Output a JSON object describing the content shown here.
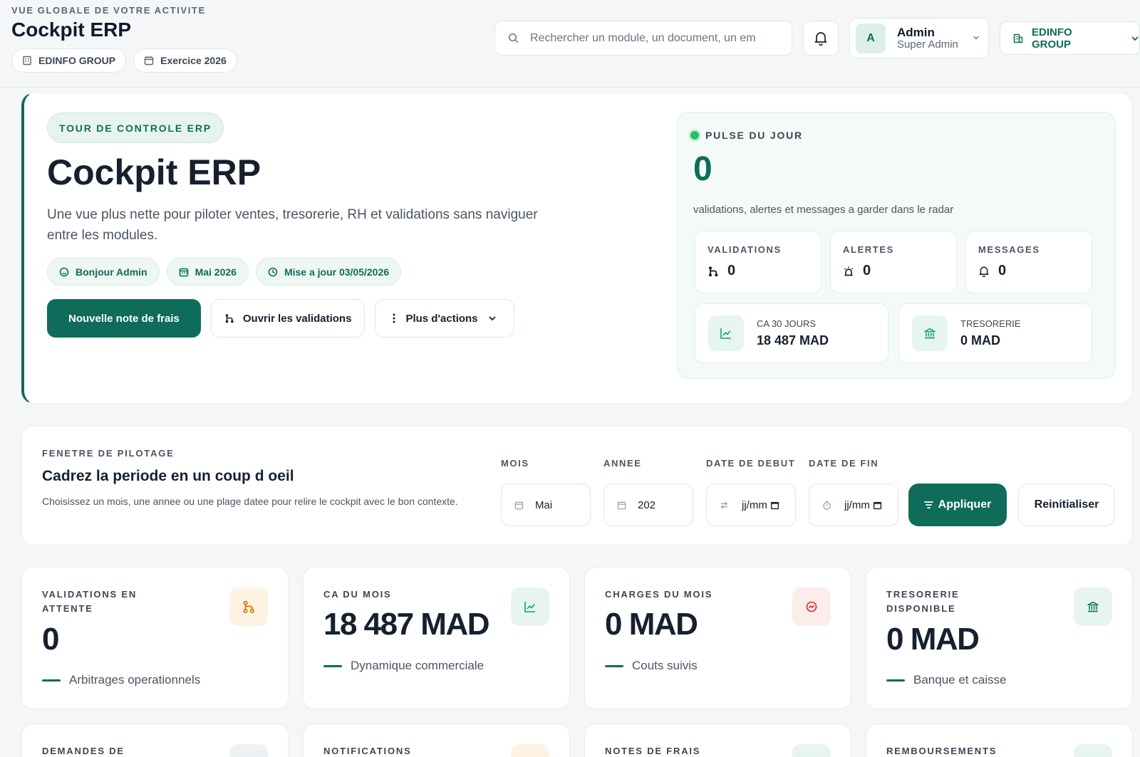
{
  "header": {
    "eyebrow": "VUE GLOBALE DE VOTRE ACTIVITE",
    "title": "Cockpit ERP",
    "company_chip": "EDINFO GROUP",
    "fiscal_chip": "Exercice 2026",
    "search_placeholder": "Rechercher un module, un document, un em",
    "user": {
      "initial": "A",
      "name": "Admin",
      "role": "Super Admin"
    },
    "company_selector": "EDINFO GROUP"
  },
  "hero": {
    "badge": "TOUR DE CONTROLE ERP",
    "title": "Cockpit ERP",
    "description": "Une vue plus nette pour piloter ventes, tresorerie, RH et validations sans naviguer entre les modules.",
    "pills": {
      "greeting": "Bonjour Admin",
      "month": "Mai 2026",
      "updated": "Mise a jour 03/05/2026"
    },
    "actions": {
      "primary": "Nouvelle note de frais",
      "validations": "Ouvrir les validations",
      "more": "Plus d'actions"
    }
  },
  "pulse": {
    "title": "PULSE DU JOUR",
    "value": "0",
    "caption": "validations, alertes et messages a garder dans le radar",
    "validations": {
      "label": "VALIDATIONS",
      "value": "0"
    },
    "alerts": {
      "label": "ALERTES",
      "value": "0"
    },
    "messages": {
      "label": "MESSAGES",
      "value": "0"
    },
    "revenue30": {
      "label": "CA 30 JOURS",
      "value": "18 487 MAD"
    },
    "treasury": {
      "label": "TRESORERIE",
      "value": "0 MAD"
    }
  },
  "filter": {
    "eyebrow": "FENETRE DE PILOTAGE",
    "title": "Cadrez la periode en un coup d oeil",
    "description": "Choisissez un mois, une annee ou une plage datee pour relire le cockpit avec le bon contexte.",
    "month": {
      "label": "MOIS",
      "value": "Mai"
    },
    "year": {
      "label": "ANNEE",
      "value": "202"
    },
    "start": {
      "label": "DATE DE DEBUT",
      "value": "jj/mm"
    },
    "end": {
      "label": "DATE DE FIN",
      "value": "jj/mm"
    },
    "apply": "Appliquer",
    "reset": "Reinitialiser"
  },
  "kpis": [
    {
      "label": "VALIDATIONS EN ATTENTE",
      "value": "0",
      "note": "Arbitrages operationnels",
      "icon": "workflow-icon",
      "icon_color": "#d97706",
      "icon_bg": "#fef3e2"
    },
    {
      "label": "CA DU MOIS",
      "value": "18 487 MAD",
      "note": "Dynamique commerciale",
      "icon": "chart-line-icon",
      "icon_color": "#1a9a78",
      "icon_bg": "#e7f5ef"
    },
    {
      "label": "CHARGES DU MOIS",
      "value": "0 MAD",
      "note": "Couts suivis",
      "icon": "gauge-icon",
      "icon_color": "#dc2626",
      "icon_bg": "#fdecec"
    },
    {
      "label": "TRESORERIE DISPONIBLE",
      "value": "0 MAD",
      "note": "Banque et caisse",
      "icon": "bank-icon",
      "icon_color": "#0f6b5a",
      "icon_bg": "#e7f5ef"
    }
  ],
  "kpis_row2": [
    {
      "label": "DEMANDES DE"
    },
    {
      "label": "NOTIFICATIONS"
    },
    {
      "label": "NOTES DE FRAIS"
    },
    {
      "label": "REMBOURSEMENTS"
    }
  ]
}
